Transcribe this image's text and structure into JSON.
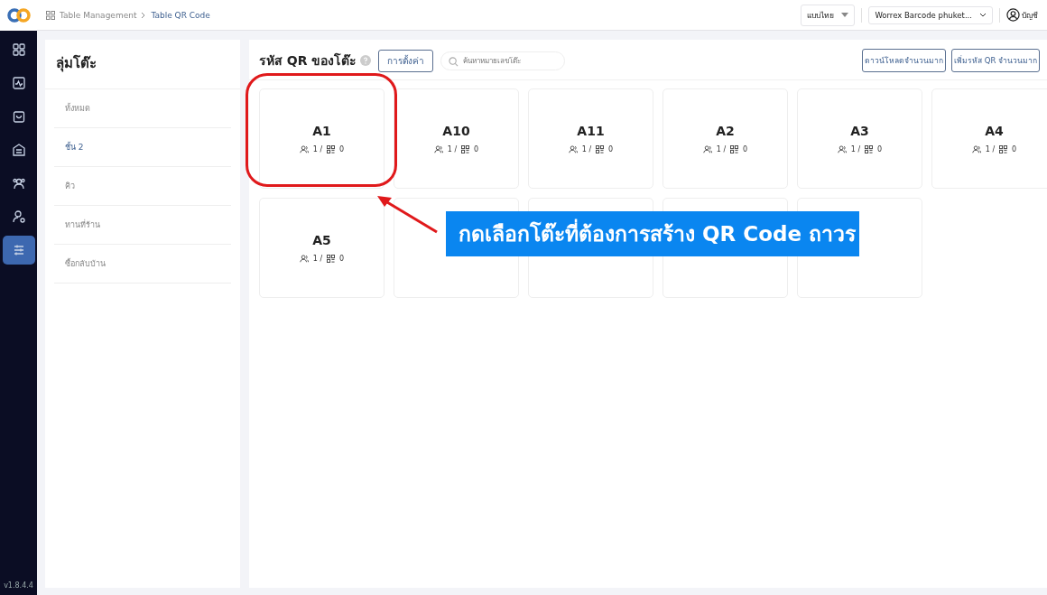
{
  "breadcrumb": [
    "Table Management",
    "Table QR Code"
  ],
  "topbar": {
    "language": "แบบไทย",
    "store": "Worrex Barcode phuket...",
    "account": "บัญชี"
  },
  "nav": [
    {
      "selected": false
    },
    {
      "selected": false
    },
    {
      "selected": false
    },
    {
      "selected": false
    },
    {
      "selected": false
    },
    {
      "selected": false
    },
    {
      "selected": true
    }
  ],
  "version": "v1.8.4.4",
  "groups": {
    "title": "ลุ่มโต๊ะ",
    "items": [
      {
        "label": "ทั้งหมด",
        "selected": false
      },
      {
        "label": "ชั้น 2",
        "selected": true
      },
      {
        "label": "คิว",
        "selected": false
      },
      {
        "label": "ทานที่ร้าน",
        "selected": false
      },
      {
        "label": "ซื้อกลับบ้าน",
        "selected": false
      }
    ]
  },
  "main": {
    "title": "รหัส QR ของโต๊ะ",
    "settings_button": "การตั้งค่า",
    "search": {
      "placeholder": "ค้นหาหมายเลขโต๊ะ"
    },
    "buttons": [
      "ดาวน์โหลดจำนวนมาก",
      "เพิ่มรหัส QR จำนวนมาก"
    ]
  },
  "tables": [
    {
      "kind": "table",
      "name": "A1",
      "seats": "1 /",
      "qr": "0"
    },
    {
      "kind": "table",
      "name": "A10",
      "seats": "1 /",
      "qr": "0"
    },
    {
      "kind": "table",
      "name": "A11",
      "seats": "1 /",
      "qr": "0"
    },
    {
      "kind": "table",
      "name": "A2",
      "seats": "1 /",
      "qr": "0"
    },
    {
      "kind": "table",
      "name": "A3",
      "seats": "1 /",
      "qr": "0"
    },
    {
      "kind": "table",
      "name": "A4",
      "seats": "1 /",
      "qr": "0"
    },
    {
      "kind": "table",
      "name": "A5",
      "seats": "1 /",
      "qr": "0"
    },
    {
      "kind": "covered"
    },
    {
      "kind": "covered"
    },
    {
      "kind": "covered"
    },
    {
      "kind": "covered"
    }
  ],
  "caption": "กดเลือกโต๊ะที่ต้องการสร้าง QR Code ถาวร"
}
